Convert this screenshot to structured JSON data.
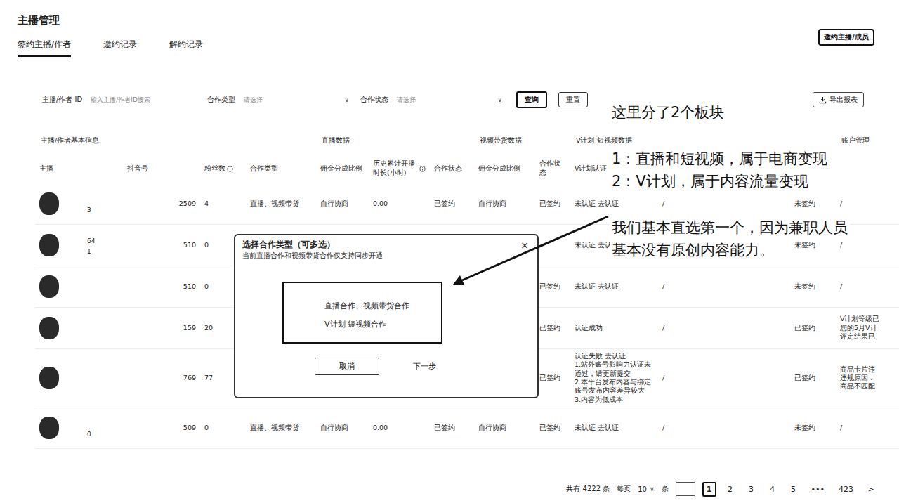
{
  "page": {
    "title": "主播管理",
    "invite_button": "邀约主播/成员"
  },
  "tabs": [
    {
      "label": "签约主播/作者",
      "selected": true
    },
    {
      "label": "邀约记录",
      "selected": false
    },
    {
      "label": "解约记录",
      "selected": false
    }
  ],
  "filters": {
    "fields": [
      {
        "label": "主播/作者 ID",
        "kind": "input",
        "placeholder": "输入主播/作者ID搜索"
      },
      {
        "label": "合作类型",
        "kind": "select",
        "value": "请选择",
        "chevron": "∨"
      },
      {
        "label": "合作状态",
        "kind": "select",
        "value": "请选择",
        "chevron": "∨"
      }
    ],
    "buttons": [
      {
        "label": "查询",
        "kind": "primary"
      },
      {
        "label": "重置",
        "kind": "default"
      }
    ],
    "export": "导出报表"
  },
  "table": {
    "groups": [
      "主播/作者基本信息",
      "直播数据",
      "视频带货数据",
      "V计划-短视频数据",
      "账户管理"
    ],
    "columns": [
      {
        "label": "主播",
        "info": false
      },
      {
        "label": "抖音号",
        "info": false
      },
      {
        "label": "粉丝数",
        "info": true
      },
      {
        "label": "合作类型",
        "info": false
      },
      {
        "label": "佣金分成比例",
        "info": false
      },
      {
        "label": "历史累计开播时长(小时)",
        "info": true
      },
      {
        "label": "合作状态",
        "info": false
      },
      {
        "label": "佣金分成比例",
        "info": false
      },
      {
        "label": "合作状态",
        "info": false
      },
      {
        "label": "V计划认证",
        "info": false
      },
      {
        "label": "",
        "info": false
      },
      {
        "label": "",
        "info": false
      },
      {
        "label": "",
        "info": false
      }
    ],
    "rows": [
      {
        "sub": "3",
        "cells": [
          "2509",
          "4",
          "直播、视频带货",
          "自行协商",
          "0.00",
          "已签约",
          "自行协商",
          "已签约",
          "未认证 去认证",
          "/",
          "未签约",
          "/"
        ]
      },
      {
        "sub": "64\n1",
        "cells": [
          "510",
          "0",
          "",
          "",
          "",
          "",
          "",
          "",
          "未认证 去认",
          "",
          "未签约",
          "/"
        ]
      },
      {
        "sub": "",
        "cells": [
          "510",
          "0",
          "",
          "",
          "",
          "",
          "",
          "已签约",
          "未认证 去认证",
          "/",
          "未签约",
          "/"
        ]
      },
      {
        "sub": "",
        "cells": [
          "159",
          "20",
          "",
          "",
          "",
          "",
          "",
          "已签约",
          "认证成功",
          "/",
          "已签约",
          "V计划等级已\n您的5月V计\n评定结果已"
        ]
      },
      {
        "sub": "",
        "cells": [
          "769",
          "77",
          "",
          "",
          "",
          "",
          "",
          "已签约",
          "认证失败 去认证\n1.站外账号影响力认证未通过，请更新提交\n2.本平台发布内容与绑定账号发布内容差异较大\n3.内容为低成本",
          "/",
          "已签约",
          "商品卡片违\n违规原因：\n商品不匹配"
        ]
      },
      {
        "sub": "0",
        "cells": [
          "509",
          "0",
          "直播、视频带货",
          "自行协商",
          "0.00",
          "已签约",
          "自行协商",
          "已签约",
          "未认证 去认证",
          "/",
          "未签约",
          "/"
        ]
      }
    ]
  },
  "pagination": {
    "total": "共有 4222 条",
    "per_page_label": "每页",
    "per_page": "10",
    "chevron": "∨",
    "unit": "条",
    "pages": [
      {
        "label": "1",
        "selected": true
      },
      {
        "label": "2",
        "selected": false
      },
      {
        "label": "3",
        "selected": false
      },
      {
        "label": "4",
        "selected": false
      },
      {
        "label": "5",
        "selected": false
      },
      {
        "label": "•••",
        "selected": false
      },
      {
        "label": "423",
        "selected": false
      }
    ],
    "next": ">"
  },
  "modal": {
    "title": "选择合作类型（可多选）",
    "close": "×",
    "note": "当前直播合作和视频带货合作仅支持同步开通",
    "options": [
      "直播合作、视频带货合作",
      "V计划-短视频合作"
    ],
    "buttons": [
      {
        "label": "取消",
        "kind": "outlined"
      },
      {
        "label": "下一步",
        "kind": "text"
      }
    ]
  },
  "annotation": {
    "groups": [
      [
        "这里分了2个板块"
      ],
      [
        "1：直播和短视频，属于电商变现",
        "2：V计划，属于内容流量变现"
      ],
      [
        "我们基本直选第一个，因为兼职人员",
        "基本没有原创内容能力。"
      ]
    ]
  }
}
